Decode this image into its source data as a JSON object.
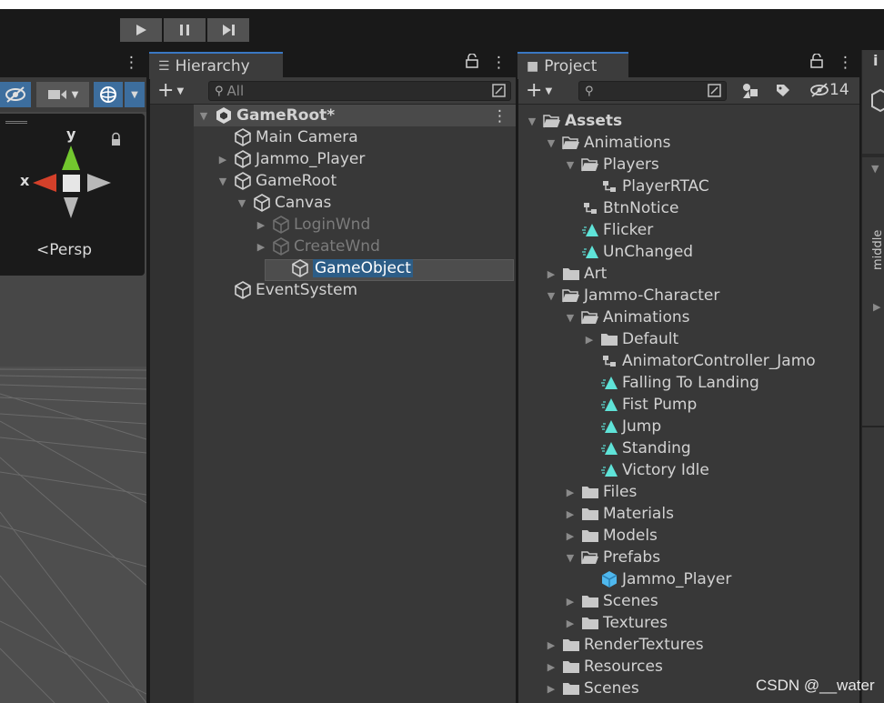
{
  "toolbar": {
    "play_icon": "play-icon",
    "pause_icon": "pause-icon",
    "step_icon": "step-icon"
  },
  "scene": {
    "menu_icon": "kebab-menu-icon",
    "gizmo_axis_y": "y",
    "gizmo_axis_x": "x",
    "projection_label": "Persp",
    "projection_prefix": "<"
  },
  "hierarchy": {
    "tab_label": "Hierarchy",
    "search_placeholder": "All",
    "add_label": "+",
    "items": [
      {
        "label": "GameRoot*",
        "depth": 0,
        "arrow": "▼",
        "icon": "unity-scene-icon",
        "bold": true
      },
      {
        "label": "Main Camera",
        "depth": 1,
        "arrow": "",
        "icon": "gameobject-cube-icon"
      },
      {
        "label": "Jammo_Player",
        "depth": 1,
        "arrow": "▶",
        "icon": "gameobject-cube-icon"
      },
      {
        "label": "GameRoot",
        "depth": 1,
        "arrow": "▼",
        "icon": "gameobject-cube-icon"
      },
      {
        "label": "Canvas",
        "depth": 2,
        "arrow": "▼",
        "icon": "gameobject-cube-icon"
      },
      {
        "label": "LoginWnd",
        "depth": 3,
        "arrow": "▶",
        "icon": "gameobject-cube-icon",
        "dim": true
      },
      {
        "label": "CreateWnd",
        "depth": 3,
        "arrow": "▶",
        "icon": "gameobject-cube-icon",
        "dim": true
      },
      {
        "label": "GameObject",
        "depth": 4,
        "arrow": "",
        "icon": "gameobject-cube-icon",
        "selected": true
      },
      {
        "label": "EventSystem",
        "depth": 1,
        "arrow": "",
        "icon": "gameobject-cube-icon"
      }
    ]
  },
  "project": {
    "tab_label": "Project",
    "add_label": "+",
    "hidden_count": "14",
    "items": [
      {
        "label": "Assets",
        "depth": 0,
        "arrow": "▼",
        "icon": "folder-open-icon",
        "bold": true
      },
      {
        "label": "Animations",
        "depth": 1,
        "arrow": "▼",
        "icon": "folder-open-icon"
      },
      {
        "label": "Players",
        "depth": 2,
        "arrow": "▼",
        "icon": "folder-open-icon"
      },
      {
        "label": "PlayerRTAC",
        "depth": 3,
        "arrow": "",
        "icon": "animator-controller-icon"
      },
      {
        "label": "BtnNotice",
        "depth": 2,
        "arrow": "",
        "icon": "animator-controller-icon"
      },
      {
        "label": "Flicker",
        "depth": 2,
        "arrow": "",
        "icon": "animation-clip-icon"
      },
      {
        "label": "UnChanged",
        "depth": 2,
        "arrow": "",
        "icon": "animation-clip-icon"
      },
      {
        "label": "Art",
        "depth": 1,
        "arrow": "▶",
        "icon": "folder-icon"
      },
      {
        "label": "Jammo-Character",
        "depth": 1,
        "arrow": "▼",
        "icon": "folder-open-icon"
      },
      {
        "label": "Animations",
        "depth": 2,
        "arrow": "▼",
        "icon": "folder-open-icon"
      },
      {
        "label": "Default",
        "depth": 3,
        "arrow": "▶",
        "icon": "folder-icon"
      },
      {
        "label": "AnimatorController_Jamo",
        "depth": 3,
        "arrow": "",
        "icon": "animator-controller-icon"
      },
      {
        "label": "Falling To Landing",
        "depth": 3,
        "arrow": "",
        "icon": "animation-clip-icon"
      },
      {
        "label": "Fist Pump",
        "depth": 3,
        "arrow": "",
        "icon": "animation-clip-icon"
      },
      {
        "label": "Jump",
        "depth": 3,
        "arrow": "",
        "icon": "animation-clip-icon"
      },
      {
        "label": "Standing",
        "depth": 3,
        "arrow": "",
        "icon": "animation-clip-icon"
      },
      {
        "label": "Victory Idle",
        "depth": 3,
        "arrow": "",
        "icon": "animation-clip-icon"
      },
      {
        "label": "Files",
        "depth": 2,
        "arrow": "▶",
        "icon": "folder-icon"
      },
      {
        "label": "Materials",
        "depth": 2,
        "arrow": "▶",
        "icon": "folder-icon"
      },
      {
        "label": "Models",
        "depth": 2,
        "arrow": "▶",
        "icon": "folder-icon"
      },
      {
        "label": "Prefabs",
        "depth": 2,
        "arrow": "▼",
        "icon": "folder-open-icon"
      },
      {
        "label": "Jammo_Player",
        "depth": 3,
        "arrow": "",
        "icon": "prefab-icon"
      },
      {
        "label": "Scenes",
        "depth": 2,
        "arrow": "▶",
        "icon": "folder-icon"
      },
      {
        "label": "Textures",
        "depth": 2,
        "arrow": "▶",
        "icon": "folder-icon"
      },
      {
        "label": "RenderTextures",
        "depth": 1,
        "arrow": "▶",
        "icon": "folder-icon"
      },
      {
        "label": "Resources",
        "depth": 1,
        "arrow": "▶",
        "icon": "folder-icon"
      },
      {
        "label": "Scenes",
        "depth": 1,
        "arrow": "▶",
        "icon": "folder-icon"
      }
    ]
  },
  "inspector": {
    "tab_icon": "info-icon",
    "side_label": "middle"
  },
  "watermark": "CSDN @__water",
  "colors": {
    "accent_tab": "#3a78c3",
    "selection": "#2c5d87",
    "anim_clip": "#5fe3d8",
    "prefab": "#4fb8ee"
  }
}
